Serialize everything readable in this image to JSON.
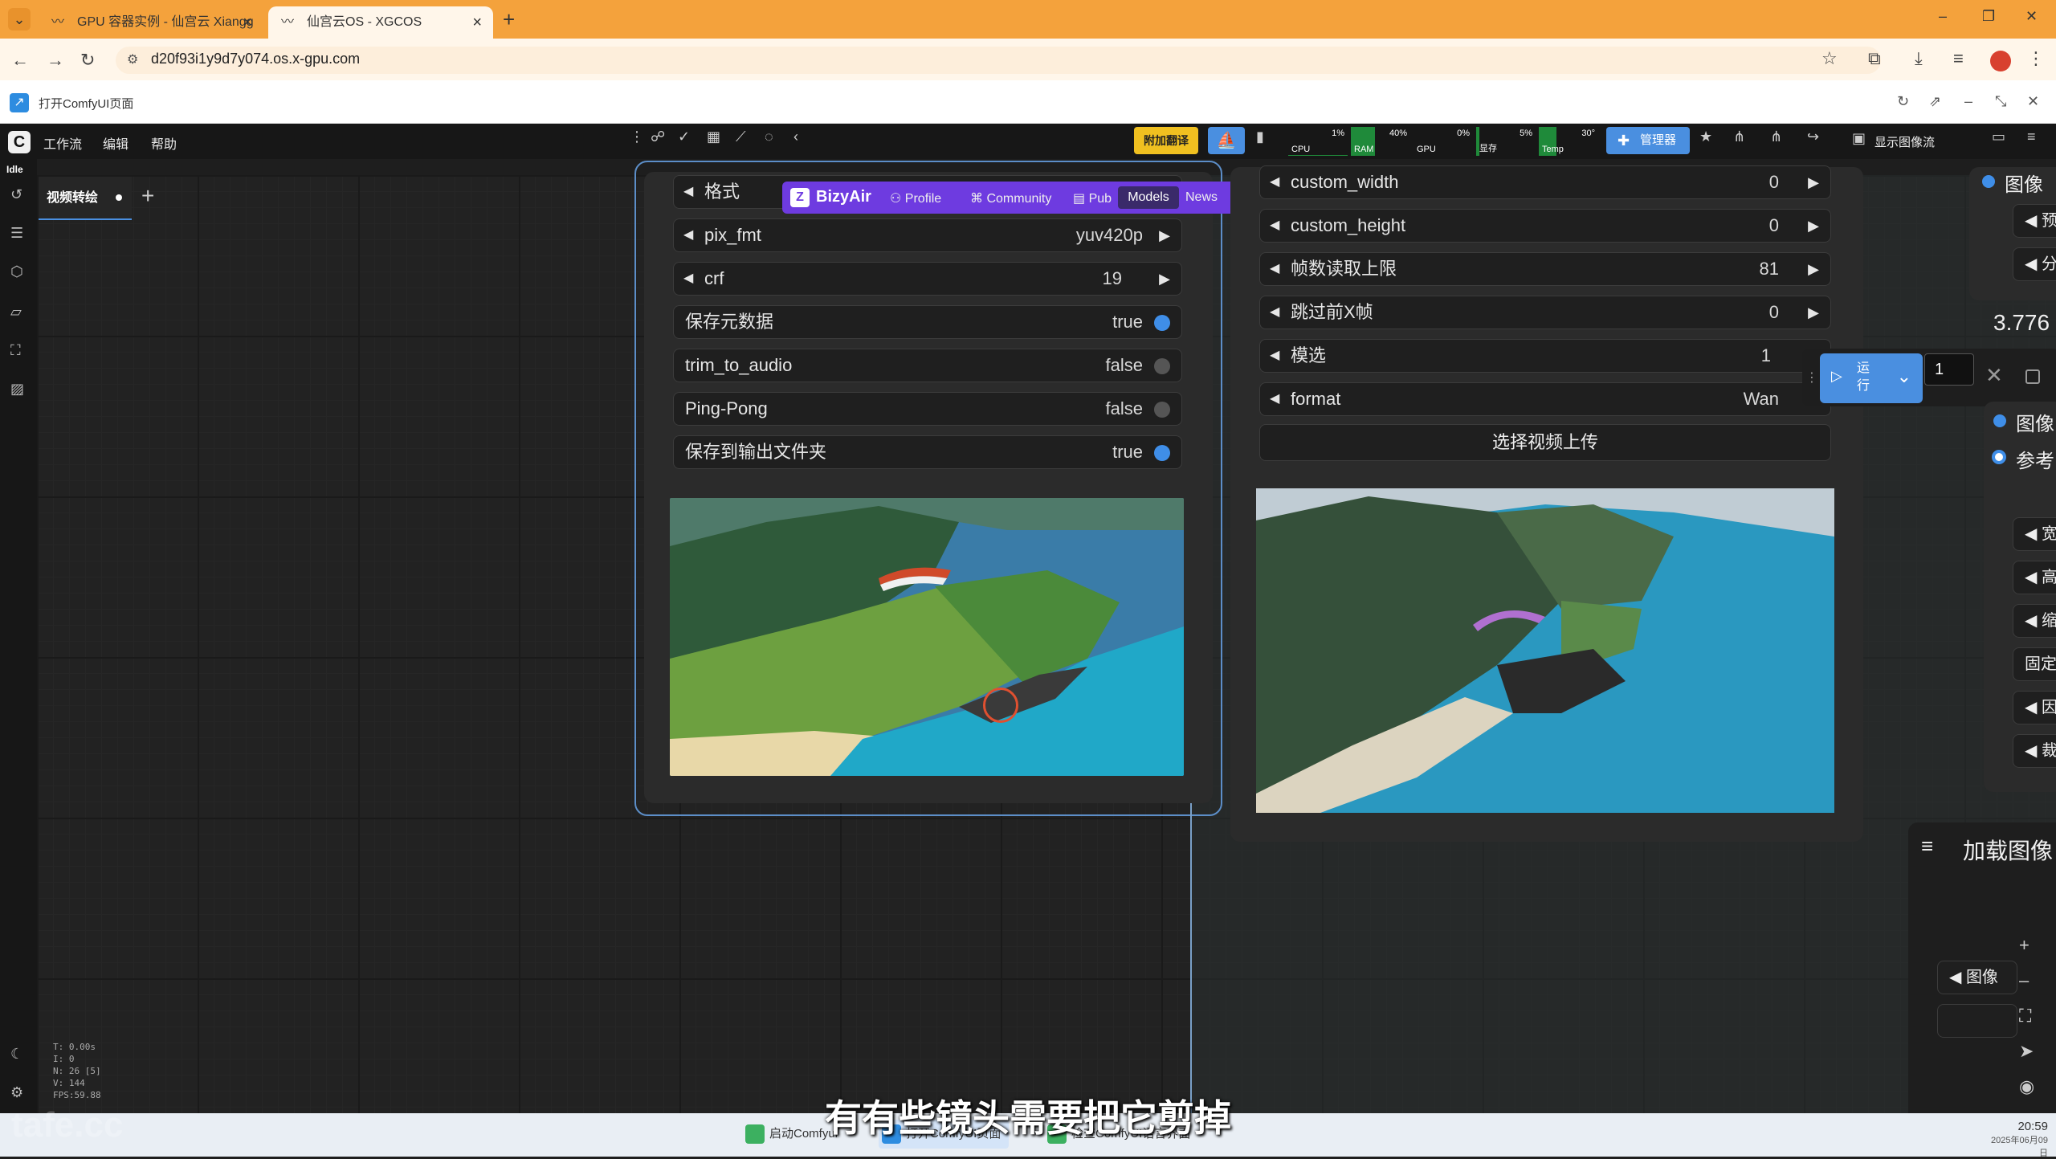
{
  "browser": {
    "tabs": [
      {
        "title": "GPU 容器实例 - 仙宫云 Xiangg",
        "close": "×"
      },
      {
        "title": "仙宫云OS - XGCOS",
        "close": "×"
      }
    ],
    "new_tab": "+",
    "url": "d20f93i1y9d7y074.os.x-gpu.com",
    "window_controls": {
      "minimize": "–",
      "restore": "❐",
      "close": "✕"
    }
  },
  "site": {
    "title": "打开ComfyUI页面"
  },
  "comfy": {
    "menu": [
      "工作流",
      "编辑",
      "帮助"
    ],
    "translate_button": "附加翻译",
    "monitor": [
      {
        "label": "CPU",
        "percent": "1%"
      },
      {
        "label": "RAM",
        "percent": "40%"
      },
      {
        "label": "GPU",
        "percent": "0%"
      },
      {
        "label": "显存",
        "percent": "5%"
      },
      {
        "label": "Temp",
        "percent": "30°"
      }
    ],
    "manage_button": "管理器",
    "show_stream": "显示图像流",
    "status": "Idle",
    "workflow_tab": "视频转绘",
    "add_tab": "+"
  },
  "bizyair": {
    "name": "BizyAir",
    "links": [
      "Profile",
      "Community",
      "Pub"
    ],
    "models": "Models",
    "news": "News"
  },
  "node_a": {
    "widgets": [
      {
        "label": "格式",
        "value": "",
        "type": "combo"
      },
      {
        "label": "pix_fmt",
        "value": "yuv420p",
        "type": "combo"
      },
      {
        "label": "crf",
        "value": "19",
        "type": "number"
      },
      {
        "label": "保存元数据",
        "value": "true",
        "type": "toggle",
        "on": true
      },
      {
        "label": "trim_to_audio",
        "value": "false",
        "type": "toggle",
        "on": false
      },
      {
        "label": "Ping-Pong",
        "value": "false",
        "type": "toggle",
        "on": false
      },
      {
        "label": "保存到输出文件夹",
        "value": "true",
        "type": "toggle",
        "on": true
      }
    ]
  },
  "node_b": {
    "widgets": [
      {
        "label": "custom_width",
        "value": "0"
      },
      {
        "label": "custom_height",
        "value": "0"
      },
      {
        "label": "帧数读取上限",
        "value": "81"
      },
      {
        "label": "跳过前X帧",
        "value": "0"
      },
      {
        "label": "模选",
        "value": "1"
      },
      {
        "label": "format",
        "value": "Wan"
      }
    ],
    "upload_button": "选择视频上传"
  },
  "run_panel": {
    "run_label": "运行",
    "count": "1"
  },
  "right_nodes": {
    "top_title": "图像",
    "top_items": [
      "预",
      "分"
    ],
    "number": "3.776",
    "inputs": [
      "图像",
      "参考"
    ],
    "widgets": [
      "宽",
      "高",
      "缩",
      "固定",
      "因",
      "裁"
    ],
    "load_node_title": "加载图像",
    "load_widget": "图像"
  },
  "stats": [
    "T: 0.00s",
    "I: 0",
    "N: 26 [5]",
    "V: 144",
    "FPS:59.88"
  ],
  "taskbar": {
    "items": [
      "启动Comfyui",
      "打开ComfyUI页面",
      "检查ComfyUI语言界面"
    ],
    "time": "20:59",
    "date": "2025年06月09日"
  },
  "subtitle": "有有些镜头需要把它剪掉",
  "watermark": "tafe.cc",
  "colors": {
    "accent_blue": "#4a8fe0",
    "bizyair_purple": "#6e3be0",
    "tab_orange": "#f4a23c",
    "translate_yellow": "#f0c020"
  }
}
